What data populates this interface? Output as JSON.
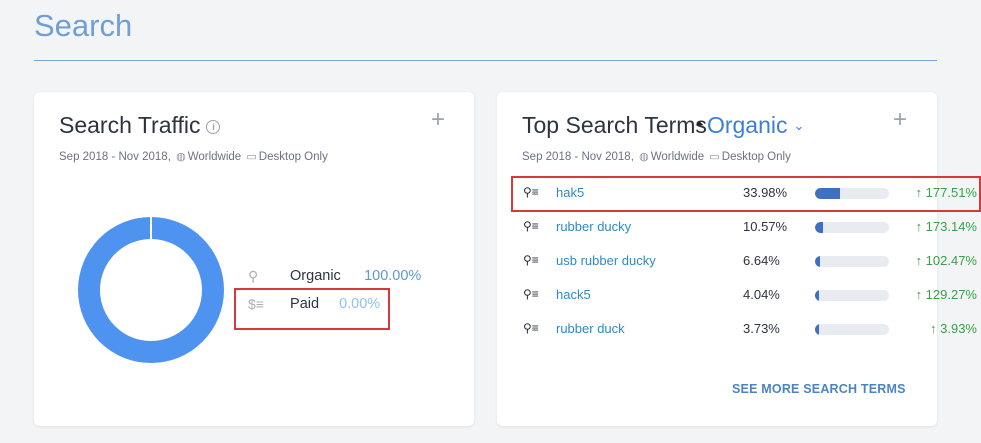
{
  "page": {
    "title": "Search"
  },
  "traffic": {
    "title": "Search Traffic",
    "info_icon": "info-icon",
    "plus_label": "+",
    "date_range": "Sep 2018 - Nov 2018,",
    "region": "Worldwide",
    "device": "Desktop Only",
    "legend": [
      {
        "label": "Organic",
        "value": "100.00%",
        "icon": "search-icon"
      },
      {
        "label": "Paid",
        "value": "0.00%",
        "icon": "paid-search-icon"
      }
    ],
    "donut": {
      "organic_share": 1.0,
      "paid_share": 0.0,
      "organic_color": "#4f93f0"
    }
  },
  "top_terms": {
    "title": "Top Search Terms",
    "filter": "Organic",
    "plus_label": "+",
    "date_range": "Sep 2018 - Nov 2018,",
    "region": "Worldwide",
    "device": "Desktop Only",
    "rows": [
      {
        "term": "hak5",
        "share": "33.98%",
        "fill": 0.34,
        "change": "↑ 177.51%"
      },
      {
        "term": "rubber ducky",
        "share": "10.57%",
        "fill": 0.1057,
        "change": "↑ 173.14%"
      },
      {
        "term": "usb rubber ducky",
        "share": "6.64%",
        "fill": 0.0664,
        "change": "↑ 102.47%"
      },
      {
        "term": "hack5",
        "share": "4.04%",
        "fill": 0.0404,
        "change": "↑ 129.27%"
      },
      {
        "term": "rubber duck",
        "share": "3.73%",
        "fill": 0.0373,
        "change": "↑ 3.93%"
      }
    ],
    "see_more": "SEE MORE SEARCH TERMS"
  },
  "colors": {
    "accent": "#4f93f0",
    "link": "#2b8cc4",
    "positive": "#3aa048",
    "highlight_border": "#d9383a"
  }
}
